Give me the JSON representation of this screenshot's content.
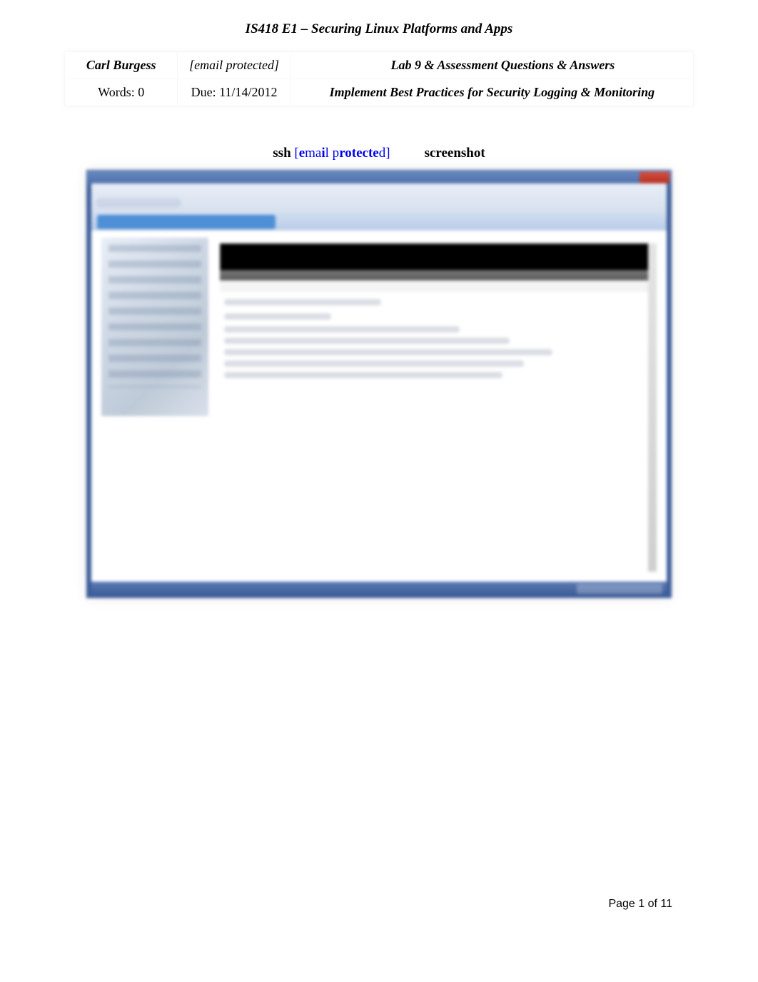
{
  "course_title": "IS418 E1 – Securing Linux Platforms and Apps",
  "header": {
    "student_name": "Carl Burgess",
    "email_placeholder": "[email protected]",
    "lab_label": "Lab 9 &  Assessment Questions & Answers",
    "words_label": "Words: 0",
    "due_label": "Due: 11/14/2012",
    "subtitle": "Implement Best Practices for Security Logging & Monitoring"
  },
  "caption": {
    "prefix": "ssh ",
    "link_full": "[email protected]",
    "suffix": "screenshot"
  },
  "footer": {
    "page_text": "Page 1 of 11"
  }
}
